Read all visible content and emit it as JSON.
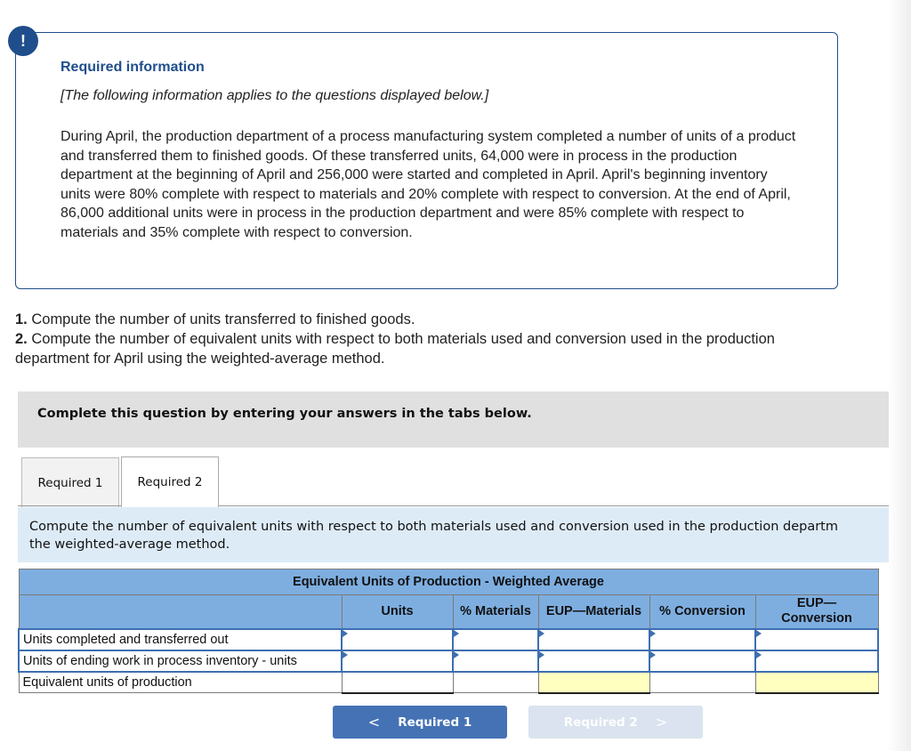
{
  "alert_icon": "exclamation-icon",
  "info": {
    "title": "Required information",
    "subtitle": "[The following information applies to the questions displayed below.]",
    "body": "During April, the production department of a process manufacturing system completed a number of units of a product and transferred them to finished goods. Of these transferred units, 64,000 were in process in the production department at the beginning of April and 256,000 were started and completed in April. April's beginning inventory units were 80% complete with respect to materials and 20% complete with respect to conversion. At the end of April, 86,000 additional units were in process in the production department and were 85% complete with respect to materials and 35% complete with respect to conversion."
  },
  "questions": [
    {
      "num": "1.",
      "text": " Compute the number of units transferred to finished goods."
    },
    {
      "num": "2.",
      "text": " Compute the number of equivalent units with respect to both materials used and conversion used in the production department for April using the weighted-average method."
    }
  ],
  "instruction": "Complete this question by entering your answers in the tabs below.",
  "tabs": [
    {
      "label": "Required 1",
      "active": false
    },
    {
      "label": "Required 2",
      "active": true
    }
  ],
  "prompt": {
    "line1": "Compute the number of equivalent units with respect to both materials used and conversion used in the production departm",
    "line2": "the weighted-average method."
  },
  "table": {
    "title": "Equivalent Units of Production - Weighted Average",
    "columns": [
      "",
      "Units",
      "% Materials",
      "EUP—Materials",
      "% Conversion",
      "EUP— Conversion"
    ],
    "rows": [
      {
        "label": "Units completed and transferred out",
        "values": [
          "",
          "",
          "",
          "",
          ""
        ]
      },
      {
        "label": "Units of ending work in process inventory - units",
        "values": [
          "",
          "",
          "",
          "",
          ""
        ]
      },
      {
        "label": "Equivalent units of production",
        "values": [
          "",
          "",
          "",
          "",
          ""
        ]
      }
    ]
  },
  "nav": {
    "prev_label": "Required 1",
    "next_label": "Required 2",
    "prev_icon": "chevron-left-icon",
    "next_icon": "chevron-right-icon"
  },
  "colors": {
    "brand_blue": "#1f4e8c",
    "table_header": "#7eaee0",
    "prompt_bg": "#ddebf7",
    "total_highlight": "#ffffc0",
    "nav_active": "#4472b4",
    "nav_disabled": "#dae3ef"
  }
}
